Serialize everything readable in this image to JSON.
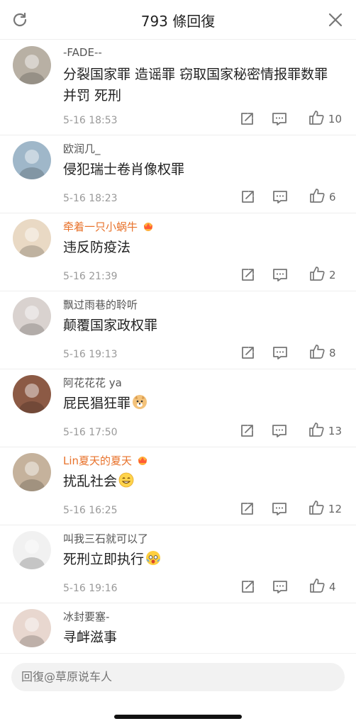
{
  "header": {
    "title": "793 條回復",
    "refresh_icon": "refresh-icon",
    "close_icon": "close-icon"
  },
  "comments": [
    {
      "user": "-FADE--",
      "vip": false,
      "text": "分裂国家罪  造谣罪  窃取国家秘密情报罪数罪并罚  死刑",
      "time": "5-16 18:53",
      "likes": "10",
      "avatar_color": "#b8b0a4"
    },
    {
      "user": "欧润几_",
      "vip": false,
      "text": "侵犯瑞士卷肖像权罪",
      "time": "5-16 18:23",
      "likes": "6",
      "avatar_color": "#9fb7c9"
    },
    {
      "user": "牵着一只小蜗牛",
      "vip": true,
      "text": "违反防疫法",
      "time": "5-16 21:39",
      "likes": "2",
      "avatar_color": "#e9d9c4"
    },
    {
      "user": "飘过雨巷的聆听",
      "vip": false,
      "text": "颠覆国家政权罪",
      "time": "5-16 19:13",
      "likes": "8",
      "avatar_color": "#d9d2cf"
    },
    {
      "user": "阿花花花 ya",
      "vip": false,
      "text": "屁民猖狂罪",
      "emoji": "doge-emoji",
      "time": "5-16 17:50",
      "likes": "13",
      "avatar_color": "#8c5a45"
    },
    {
      "user": "Lin夏天的夏天",
      "vip": true,
      "text": "扰乱社会",
      "emoji": "grin-emoji",
      "time": "5-16 16:25",
      "likes": "12",
      "avatar_color": "#c5b29c"
    },
    {
      "user": "叫我三石就可以了",
      "vip": false,
      "text": "死刑立即执行",
      "emoji": "shock-emoji",
      "time": "5-16 19:16",
      "likes": "4",
      "avatar_color": "#f1f1f1"
    },
    {
      "user": "冰封要塞-",
      "vip": false,
      "text": "寻衅滋事",
      "time": "",
      "likes": "",
      "avatar_color": "#e8d7cf"
    }
  ],
  "footer": {
    "reply_placeholder": "回復@草原说车人"
  },
  "colors": {
    "accent": "#e8722b",
    "muted": "#999999",
    "divider": "#eeeeee"
  }
}
